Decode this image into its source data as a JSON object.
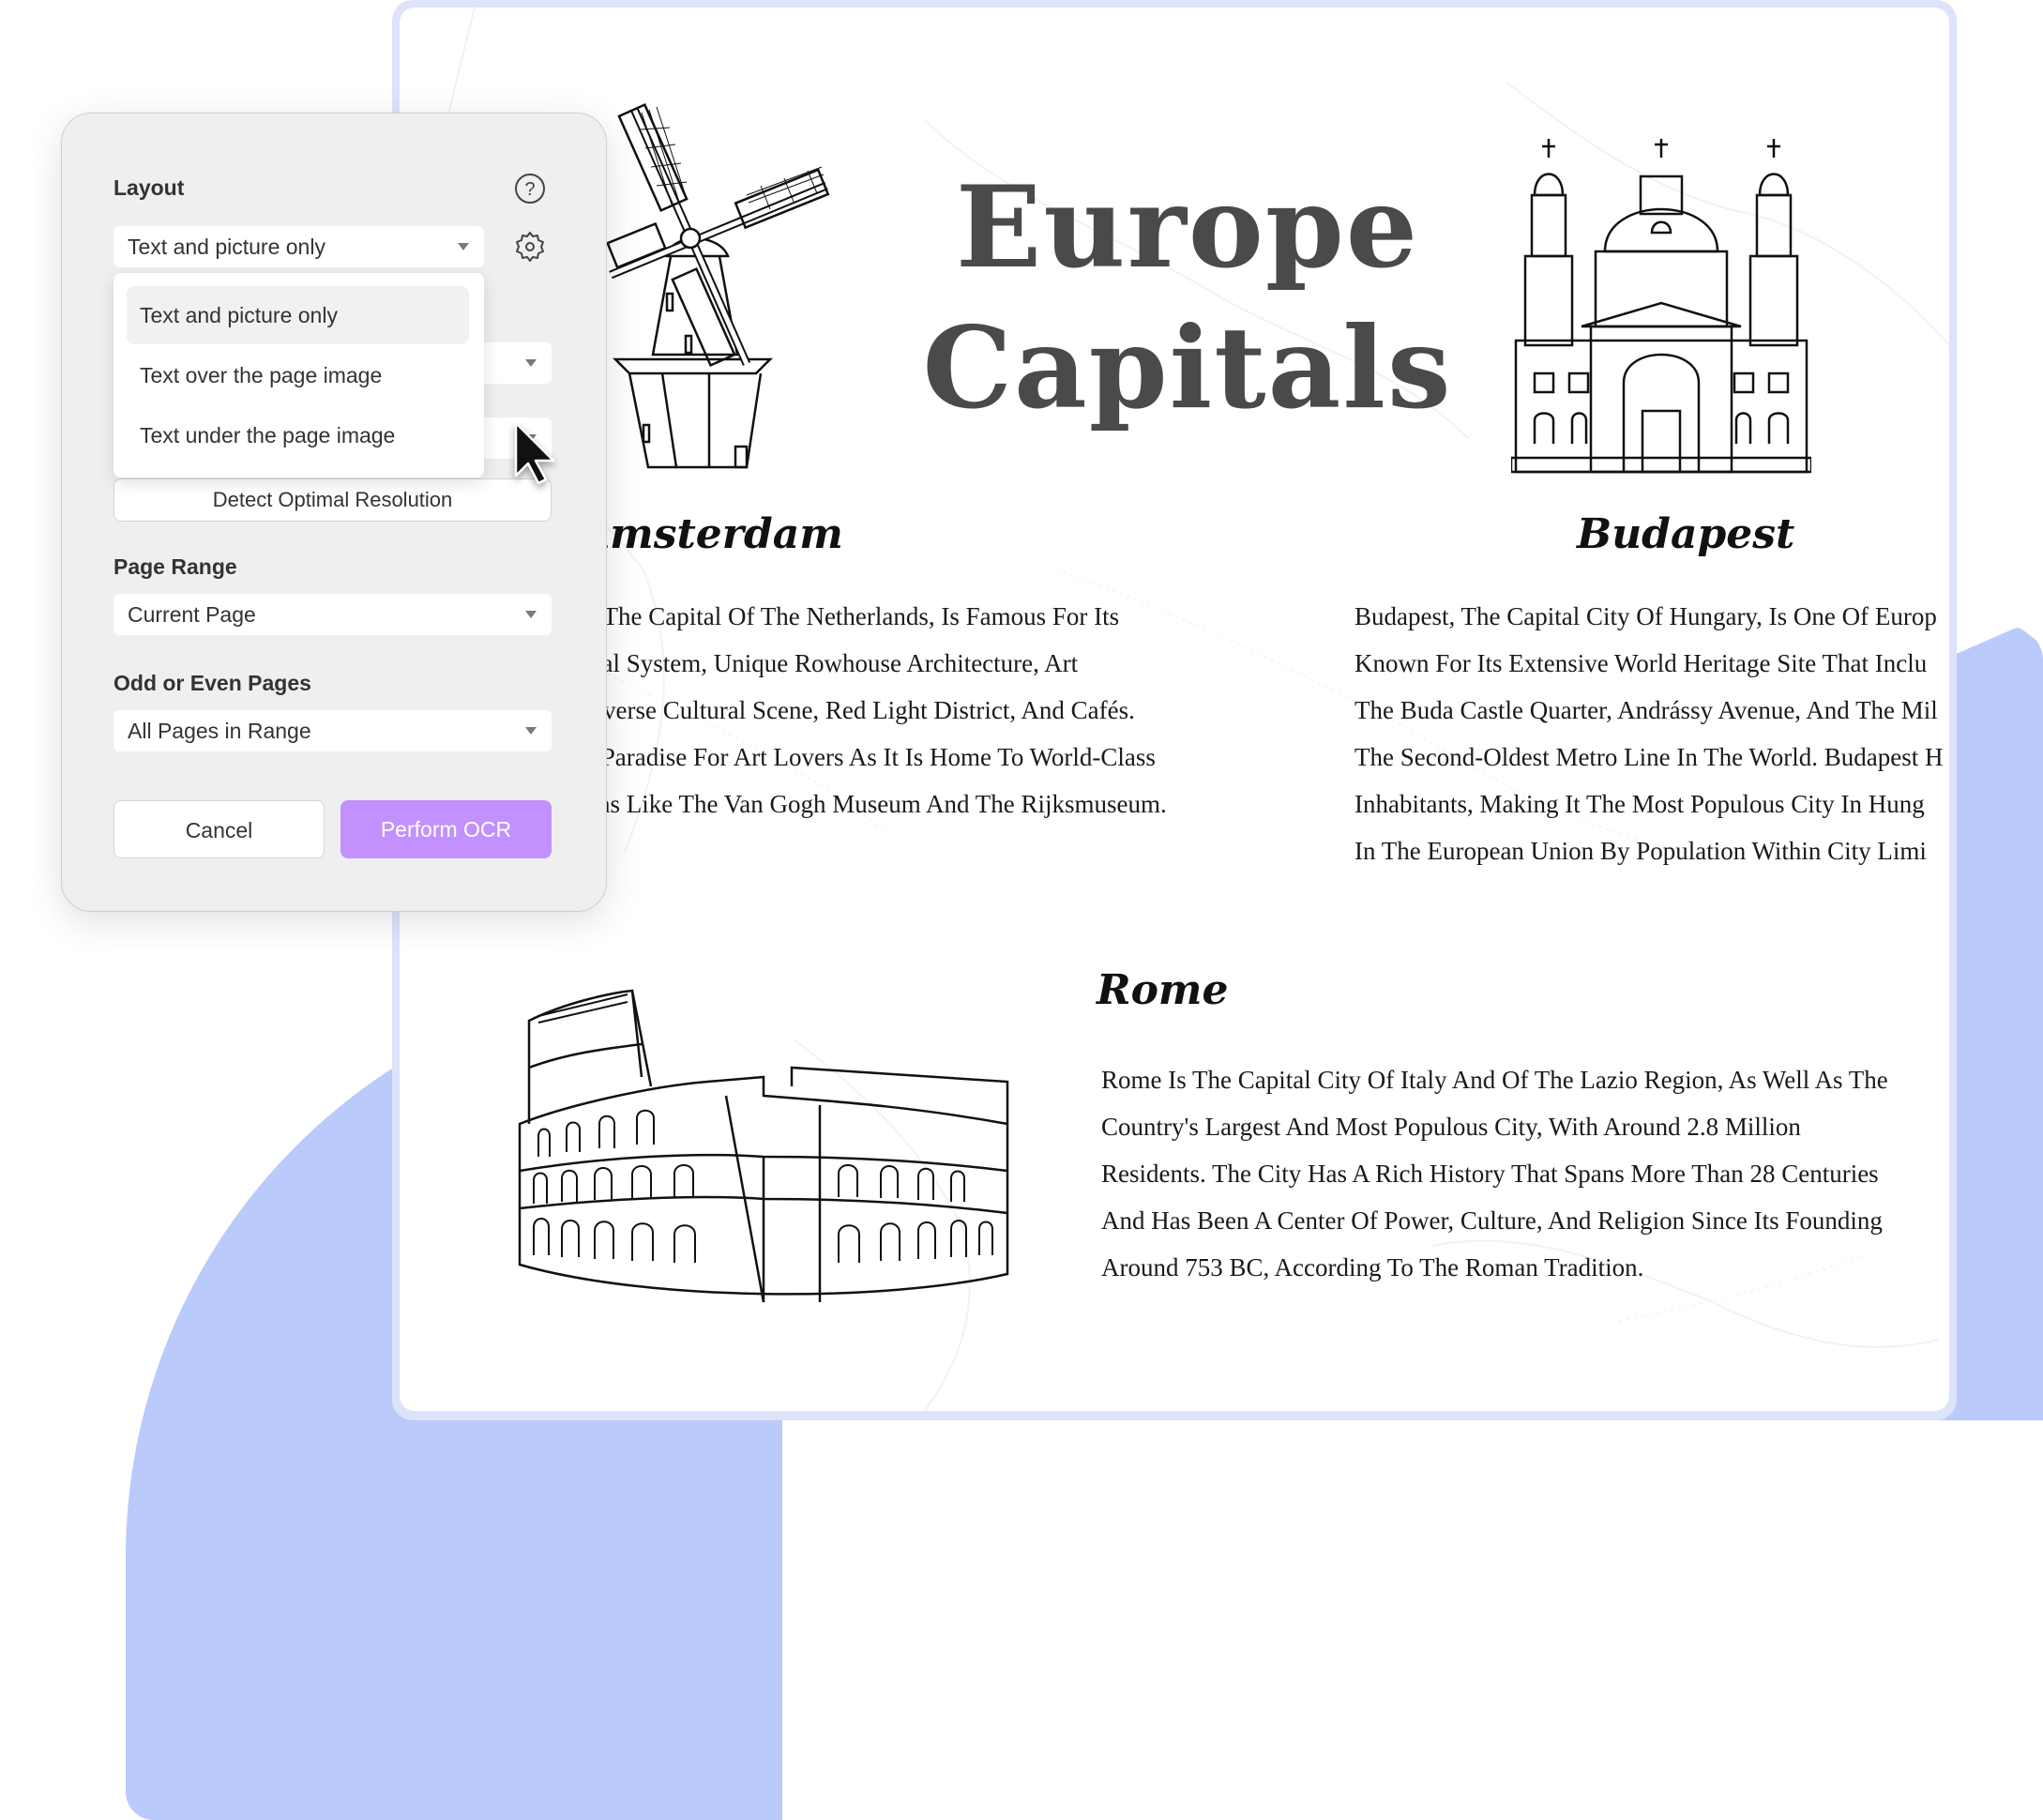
{
  "document": {
    "title_line1": "Europe",
    "title_line2": "Capitals",
    "sections": [
      {
        "city": "Amsterdam",
        "city_visible": "Amsterdam",
        "lines": [
          "n, The Capital Of The Netherlands, Is Famous For Its",
          "anal System, Unique Rowhouse Architecture, Art",
          "Diverse Cultural Scene, Red Light District, And Cafés.",
          " A Paradise For Art Lovers As It Is Home To World-Class",
          "ions Like The Van Gogh Museum And The Rijksmuseum."
        ],
        "illustration": "windmill-illustration"
      },
      {
        "city": "Budapest",
        "lines": [
          "Budapest, The Capital City Of Hungary, Is One Of Europ",
          "Known For Its Extensive World Heritage Site That Inclu",
          "The Buda Castle Quarter, Andrássy Avenue, And The Mil",
          "The Second-Oldest Metro Line In The World. Budapest H",
          "Inhabitants, Making It The Most Populous City In Hung",
          "In The European Union By Population Within City Limi"
        ],
        "illustration": "basilica-illustration"
      },
      {
        "city": "Rome",
        "lines": [
          "Rome Is The Capital City Of Italy And Of The Lazio Region, As Well As The",
          "Country's Largest And Most Populous City, With Around 2.8 Million",
          "Residents. The City Has A Rich History That Spans More Than 28 Centuries",
          "And Has Been A Center Of Power, Culture, And Religion Since Its Founding",
          "Around 753 BC, According To The Roman Tradition."
        ],
        "illustration": "colosseum-illustration"
      }
    ]
  },
  "dialog": {
    "layout_label": "Layout",
    "help_icon": "question-circle-icon",
    "settings_icon": "gear-icon",
    "layout_select": {
      "value": "Text and picture only"
    },
    "layout_options": [
      {
        "label": "Text and picture only",
        "selected": true
      },
      {
        "label": "Text over the page image",
        "selected": false
      },
      {
        "label": "Text under the page image",
        "selected": false
      }
    ],
    "detect_button": "Detect Optimal Resolution",
    "page_range_label": "Page Range",
    "page_range_value": "Current Page",
    "odd_even_label": "Odd or Even Pages",
    "odd_even_value": "All Pages in Range",
    "cancel_button": "Cancel",
    "ocr_button": "Perform OCR"
  },
  "colors": {
    "accent_purple": "#c291fd",
    "background_blue": "#b9cafb",
    "frame_blue": "#dce3fb",
    "dialog_bg": "#efefef",
    "title_gray": "#4a4a4a"
  }
}
